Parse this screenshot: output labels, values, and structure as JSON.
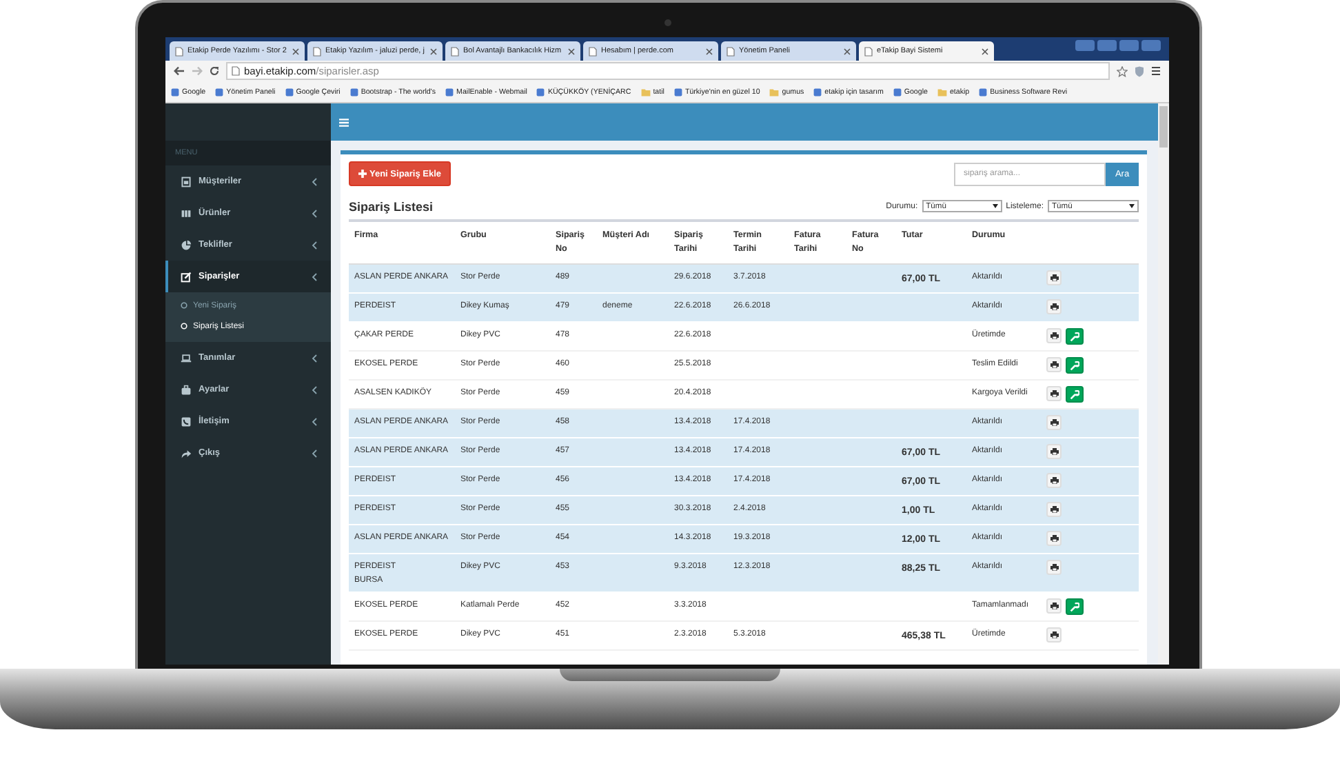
{
  "browser": {
    "tabs": [
      {
        "title": "Etakip Perde Yazılımı - Stor 2",
        "selected": false
      },
      {
        "title": "Etakip Yazılım - jaluzi perde, j",
        "selected": false
      },
      {
        "title": "Bol Avantajlı Bankacılık Hizm",
        "selected": false
      },
      {
        "title": "Hesabım | perde.com",
        "selected": false
      },
      {
        "title": "Yönetim Paneli",
        "selected": false
      },
      {
        "title": "eTakip Bayi Sistemi",
        "selected": true
      }
    ],
    "address": {
      "host": "bayi.etakip.com",
      "path": "/siparisler.asp"
    },
    "bookmarks": [
      {
        "label": "Google",
        "kind": "link"
      },
      {
        "label": "Yönetim Paneli",
        "kind": "link"
      },
      {
        "label": "Google Çeviri",
        "kind": "link"
      },
      {
        "label": "Bootstrap - The world's",
        "kind": "link"
      },
      {
        "label": "MailEnable - Webmail",
        "kind": "link"
      },
      {
        "label": "KÜÇÜKKÖY (YENİÇARC",
        "kind": "link"
      },
      {
        "label": "tatil",
        "kind": "folder"
      },
      {
        "label": "Türkiye'nin en güzel 10",
        "kind": "link"
      },
      {
        "label": "gumus",
        "kind": "folder"
      },
      {
        "label": "etakip için tasarım",
        "kind": "link"
      },
      {
        "label": "Google",
        "kind": "link"
      },
      {
        "label": "etakip",
        "kind": "folder"
      },
      {
        "label": "Business Software Revi",
        "kind": "link"
      }
    ]
  },
  "sidebar": {
    "header": "MENU",
    "items": [
      {
        "label": "Müşteriler",
        "selected": false
      },
      {
        "label": "Ürünler",
        "selected": false
      },
      {
        "label": "Teklifler",
        "selected": false
      },
      {
        "label": "Siparişler",
        "selected": true,
        "expanded": true,
        "children": [
          {
            "label": "Yeni Sipariş",
            "selected": false
          },
          {
            "label": "Sipariş Listesi",
            "selected": true
          }
        ]
      },
      {
        "label": "Tanımlar",
        "selected": false
      },
      {
        "label": "Ayarlar",
        "selected": false
      },
      {
        "label": "İletişim",
        "selected": false
      },
      {
        "label": "Çıkış",
        "selected": false
      }
    ]
  },
  "toolbar": {
    "add_button": "Yeni Sipariş Ekle",
    "search": {
      "placeholder": "sipariş arama...",
      "button": "Ara"
    }
  },
  "orders": {
    "title": "Sipariş Listesi",
    "filters": [
      {
        "label": "Durumu:",
        "value": "Tümü"
      },
      {
        "label": "Listeleme:",
        "value": "Tümü"
      }
    ],
    "columns": [
      "Firma",
      "Grubu",
      "Sipariş No",
      "Müşteri Adı",
      "Sipariş Tarihi",
      "Termin Tarihi",
      "Fatura Tarihi",
      "Fatura No",
      "Tutar",
      "Durumu"
    ],
    "rows": [
      {
        "firma": [
          "ASLAN PERDE ANKARA"
        ],
        "grubu": "Stor Perde",
        "no": "489",
        "siparis_tarihi": "29.6.2018",
        "termin_tarihi": "3.7.2018",
        "tutar": "67,00 TL",
        "durumu": "Aktarıldı",
        "highlighted": true,
        "editable": false
      },
      {
        "firma": [
          "PERDEIST"
        ],
        "grubu": "Dikey Kumaş",
        "no": "479",
        "musteri": "deneme",
        "siparis_tarihi": "22.6.2018",
        "termin_tarihi": "26.6.2018",
        "durumu": "Aktarıldı",
        "highlighted": true,
        "editable": false
      },
      {
        "firma": [
          "ÇAKAR PERDE"
        ],
        "grubu": "Dikey PVC",
        "no": "478",
        "siparis_tarihi": "22.6.2018",
        "durumu": "Üretimde",
        "highlighted": false,
        "editable": true
      },
      {
        "firma": [
          "EKOSEL PERDE"
        ],
        "grubu": "Stor Perde",
        "no": "460",
        "siparis_tarihi": "25.5.2018",
        "durumu": "Teslim Edildi",
        "highlighted": false,
        "editable": true
      },
      {
        "firma": [
          "ASALSEN KADIKÖY"
        ],
        "grubu": "Stor Perde",
        "no": "459",
        "siparis_tarihi": "20.4.2018",
        "durumu": "Kargoya Verildi",
        "highlighted": false,
        "editable": true
      },
      {
        "firma": [
          "ASLAN PERDE ANKARA"
        ],
        "grubu": "Stor Perde",
        "no": "458",
        "siparis_tarihi": "13.4.2018",
        "termin_tarihi": "17.4.2018",
        "durumu": "Aktarıldı",
        "highlighted": true,
        "editable": false
      },
      {
        "firma": [
          "ASLAN PERDE ANKARA"
        ],
        "grubu": "Stor Perde",
        "no": "457",
        "siparis_tarihi": "13.4.2018",
        "termin_tarihi": "17.4.2018",
        "tutar": "67,00 TL",
        "durumu": "Aktarıldı",
        "highlighted": true,
        "editable": false
      },
      {
        "firma": [
          "PERDEIST"
        ],
        "grubu": "Stor Perde",
        "no": "456",
        "siparis_tarihi": "13.4.2018",
        "termin_tarihi": "17.4.2018",
        "tutar": "67,00 TL",
        "durumu": "Aktarıldı",
        "highlighted": true,
        "editable": false
      },
      {
        "firma": [
          "PERDEIST"
        ],
        "grubu": "Stor Perde",
        "no": "455",
        "siparis_tarihi": "30.3.2018",
        "termin_tarihi": "2.4.2018",
        "tutar": "1,00 TL",
        "durumu": "Aktarıldı",
        "highlighted": true,
        "editable": false
      },
      {
        "firma": [
          "ASLAN PERDE ANKARA"
        ],
        "grubu": "Stor Perde",
        "no": "454",
        "siparis_tarihi": "14.3.2018",
        "termin_tarihi": "19.3.2018",
        "tutar": "12,00 TL",
        "durumu": "Aktarıldı",
        "highlighted": true,
        "editable": false
      },
      {
        "firma": [
          "PERDEIST",
          "BURSA"
        ],
        "grubu": "Dikey PVC",
        "no": "453",
        "siparis_tarihi": "9.3.2018",
        "termin_tarihi": "12.3.2018",
        "tutar": "88,25 TL",
        "durumu": "Aktarıldı",
        "highlighted": true,
        "editable": false
      },
      {
        "firma": [
          "EKOSEL PERDE"
        ],
        "grubu": "Katlamalı Perde",
        "no": "452",
        "siparis_tarihi": "3.3.2018",
        "durumu": "Tamamlanmadı",
        "highlighted": false,
        "editable": true
      },
      {
        "firma": [
          "EKOSEL PERDE"
        ],
        "grubu": "Dikey PVC",
        "no": "451",
        "siparis_tarihi": "2.3.2018",
        "termin_tarihi": "5.3.2018",
        "tutar": "465,38 TL",
        "durumu": "Üretimde",
        "highlighted": false,
        "editable": false
      }
    ]
  }
}
